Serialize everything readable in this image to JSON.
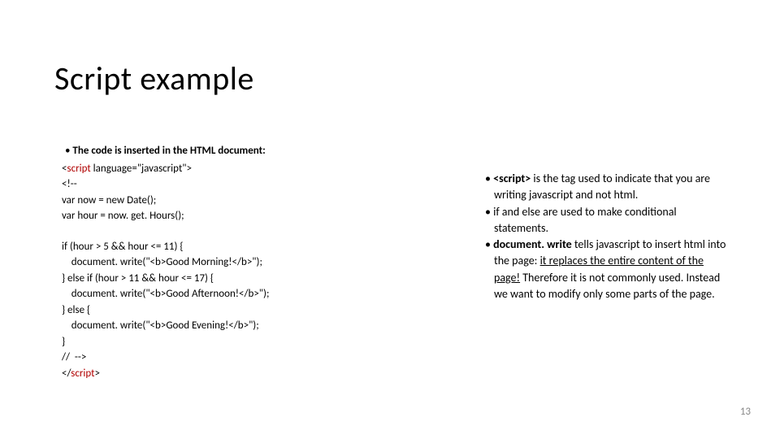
{
  "title": "Script example",
  "left": {
    "intro": "The code is inserted in the HTML document:",
    "lines1": [
      {
        "pre": "<",
        "tag": "script",
        "post": " language=\"javascript\">"
      },
      {
        "pre": "<!--",
        "tag": "",
        "post": ""
      },
      {
        "pre": "var now = new Date();",
        "tag": "",
        "post": ""
      },
      {
        "pre": "var hour = now. get. Hours();",
        "tag": "",
        "post": ""
      }
    ],
    "lines2": [
      {
        "pre": "if (hour > 5 && hour <= 11) {",
        "tag": "",
        "post": ""
      },
      {
        "pre": "    document. write(\"<b>Good Morning!</b>\");",
        "tag": "",
        "post": ""
      },
      {
        "pre": "} else if (hour > 11 && hour <= 17) {",
        "tag": "",
        "post": ""
      },
      {
        "pre": "    document. write(\"<b>Good Afternoon!</b>\");",
        "tag": "",
        "post": ""
      },
      {
        "pre": "} else {",
        "tag": "",
        "post": ""
      },
      {
        "pre": "    document. write(\"<b>Good Evening!</b>\");",
        "tag": "",
        "post": ""
      },
      {
        "pre": "}",
        "tag": "",
        "post": ""
      },
      {
        "pre": "//  -->",
        "tag": "",
        "post": ""
      },
      {
        "pre": "</",
        "tag": "script",
        "post": ">"
      }
    ]
  },
  "right": {
    "items": [
      {
        "segments": [
          {
            "t": "<script>",
            "cls": "b"
          },
          {
            "t": " is the tag used to indicate that you are writing javascript and not html.",
            "cls": ""
          }
        ]
      },
      {
        "segments": [
          {
            "t": "if and else are used to make conditional statements.",
            "cls": ""
          }
        ]
      },
      {
        "segments": [
          {
            "t": "document. write",
            "cls": "b"
          },
          {
            "t": " tells javascript to insert html into the page: ",
            "cls": ""
          },
          {
            "t": "it replaces the entire content of the page!",
            "cls": "u"
          },
          {
            "t": " Therefore it is not commonly used. Instead we want to modify only some parts of the page.",
            "cls": ""
          }
        ]
      }
    ]
  },
  "pagenum": "13"
}
